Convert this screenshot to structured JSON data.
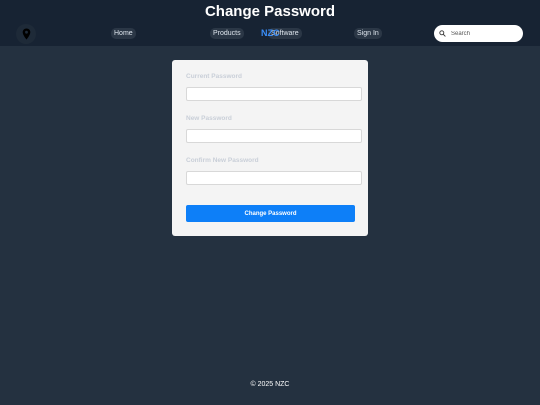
{
  "header": {
    "title": "Change Password",
    "logo_icon": "map-pin-icon",
    "brand": "NZC",
    "nav": {
      "home": "Home",
      "products": "Products",
      "software": "Software",
      "sign_in": "Sign In"
    },
    "search": {
      "placeholder": "Search",
      "icon": "search-icon"
    }
  },
  "form": {
    "current_password_label": "Current Password",
    "new_password_label": "New Password",
    "confirm_password_label": "Confirm New Password",
    "submit_label": "Change Password"
  },
  "footer": {
    "text": "© 2025 NZC"
  },
  "colors": {
    "header_bg": "#172333",
    "page_bg": "#243140",
    "card_bg": "#f4f4f4",
    "accent": "#0d7ff8",
    "brand": "#3a8df7"
  }
}
